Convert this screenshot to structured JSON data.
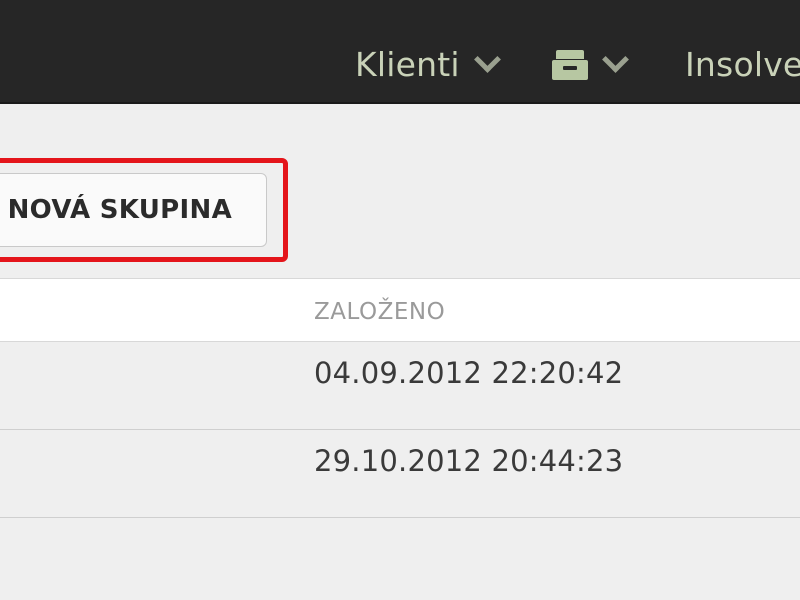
{
  "nav": {
    "items": [
      {
        "label": "Klienti",
        "icon": "chevron-down-icon"
      },
      {
        "label": "",
        "icon": "archive-box-icon"
      },
      {
        "label": "Insolvence",
        "icon": "chevron-down-icon"
      }
    ]
  },
  "toolbar": {
    "new_group_label": "NOVÁ SKUPINA",
    "highlight_color": "#e4151b"
  },
  "table": {
    "columns": [
      "ZALOŽENO"
    ],
    "rows": [
      {
        "zalozeno": "04.09.2012 22:20:42"
      },
      {
        "zalozeno": "29.10.2012 20:44:23"
      }
    ]
  }
}
